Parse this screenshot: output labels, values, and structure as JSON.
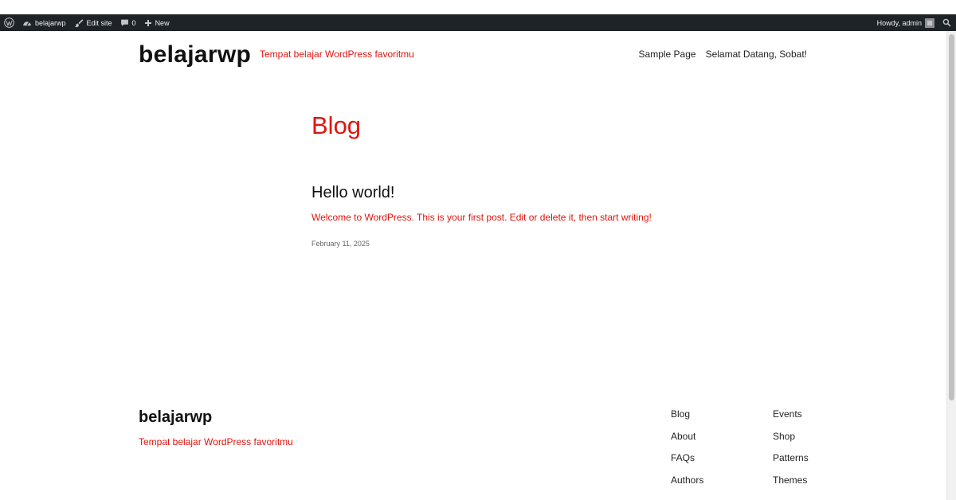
{
  "admin_bar": {
    "site_name": "belajarwp",
    "edit_site": "Edit site",
    "comments_count": "0",
    "new": "New",
    "howdy": "Howdy, admin"
  },
  "header": {
    "site_title": "belajarwp",
    "tagline": "Tempat belajar WordPress favoritmu",
    "nav": [
      "Sample Page",
      "Selamat Datang, Sobat!"
    ]
  },
  "main": {
    "heading": "Blog",
    "post": {
      "title": "Hello world!",
      "excerpt": "Welcome to WordPress. This is your first post. Edit or delete it, then start writing!",
      "date": "February 11, 2025"
    }
  },
  "footer": {
    "site_title": "belajarwp",
    "tagline": "Tempat belajar WordPress favoritmu",
    "links_col1": [
      "Blog",
      "About",
      "FAQs",
      "Authors"
    ],
    "links_col2": [
      "Events",
      "Shop",
      "Patterns",
      "Themes"
    ]
  },
  "colors": {
    "accent": "#e0140e",
    "admin_bar_bg": "#1d2327"
  }
}
